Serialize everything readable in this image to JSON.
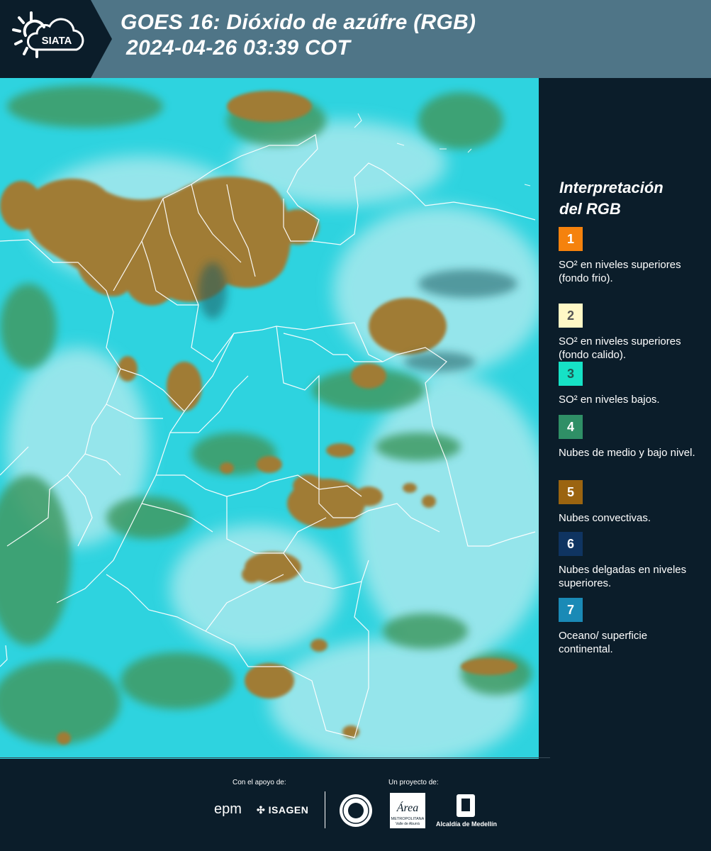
{
  "header": {
    "logo_text": "SIATA",
    "title_line1": "GOES 16: Dióxido de azúfre (RGB)",
    "title_line2": "2024-04-26 03:39 COT",
    "background_color": "#4f7587"
  },
  "legend": {
    "title_line1": "Interpretación",
    "title_line2": "del RGB",
    "items": [
      {
        "number": "1",
        "color": "#f5820d",
        "text_color": "#ffffff",
        "description": "SO² en niveles superiores (fondo frio)."
      },
      {
        "number": "2",
        "color": "#fff8c6",
        "text_color": "#555555",
        "description": "SO² en niveles superiores (fondo calido)."
      },
      {
        "number": "3",
        "color": "#16e2c6",
        "text_color": "#1f5a52",
        "description": "SO² en niveles bajos."
      },
      {
        "number": "4",
        "color": "#2f8f66",
        "text_color": "#ffffff",
        "description": "Nubes de medio y bajo nivel."
      },
      {
        "number": "5",
        "color": "#9b6410",
        "text_color": "#ffffff",
        "description": "Nubes convectivas."
      },
      {
        "number": "6",
        "color": "#0f3461",
        "text_color": "#ffffff",
        "description": "Nubes delgadas en niveles superiores."
      },
      {
        "number": "7",
        "color": "#1a8ab6",
        "text_color": "#ffffff",
        "description": "Oceano/ superficie continental."
      }
    ]
  },
  "map": {
    "palette": {
      "ocean_surface": "#2ed3df",
      "low_mid_cloud": "#3f9a63",
      "convective_cloud": "#a07c35",
      "thin_high_cloud": "#b8ecef",
      "boundary_line": "#ffffff"
    },
    "icons": [
      "siata-sun-cloud-icon"
    ]
  },
  "footer": {
    "support_label": "Con el apoyo de:",
    "project_label": "Un proyecto de:",
    "sponsors": [
      "epm",
      "ISAGEN"
    ],
    "partners": {
      "amva_line1": "Área",
      "amva_line2": "METROPOLITANA",
      "amva_line3": "Valle de Aburrá",
      "alcaldia": "Alcaldía de Medellín"
    }
  }
}
